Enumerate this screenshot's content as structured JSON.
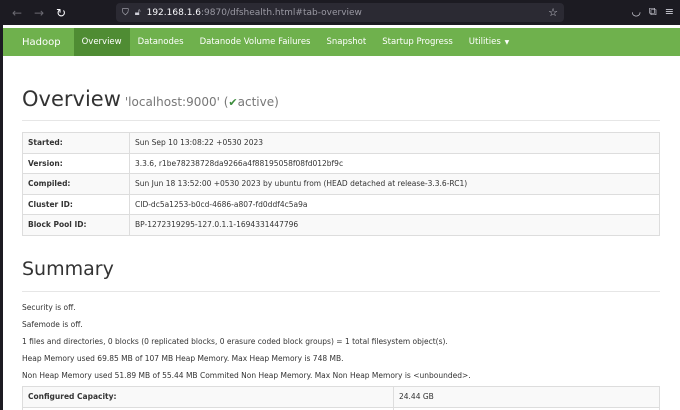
{
  "browser": {
    "url_host": "192.168.1.6",
    "url_path": ":9870/dfshealth.html#tab-overview"
  },
  "navbar": {
    "brand": "Hadoop",
    "items": [
      {
        "label": "Overview"
      },
      {
        "label": "Datanodes"
      },
      {
        "label": "Datanode Volume Failures"
      },
      {
        "label": "Snapshot"
      },
      {
        "label": "Startup Progress"
      },
      {
        "label": "Utilities"
      }
    ]
  },
  "overview": {
    "title": "Overview",
    "host": "'localhost:9000' (",
    "status": "active",
    "status_close": ")",
    "rows": [
      {
        "key": "Started:",
        "value": "Sun Sep 10 13:08:22 +0530 2023"
      },
      {
        "key": "Version:",
        "value": "3.3.6, r1be78238728da9266a4f88195058f08fd012bf9c"
      },
      {
        "key": "Compiled:",
        "value": "Sun Jun 18 13:52:00 +0530 2023 by ubuntu from (HEAD detached at release-3.3.6-RC1)"
      },
      {
        "key": "Cluster ID:",
        "value": "CID-dc5a1253-b0cd-4686-a807-fd0ddf4c5a9a"
      },
      {
        "key": "Block Pool ID:",
        "value": "BP-1272319295-127.0.1.1-1694331447796"
      }
    ]
  },
  "summary": {
    "title": "Summary",
    "lines": [
      "Security is off.",
      "Safemode is off.",
      "1 files and directories, 0 blocks (0 replicated blocks, 0 erasure coded block groups) = 1 total filesystem object(s).",
      "Heap Memory used 69.85 MB of 107 MB Heap Memory. Max Heap Memory is 748 MB.",
      "Non Heap Memory used 51.89 MB of 55.44 MB Commited Non Heap Memory. Max Non Heap Memory is <unbounded>."
    ],
    "capacity": {
      "key": "Configured Capacity:",
      "value": "24.44 GB"
    }
  }
}
